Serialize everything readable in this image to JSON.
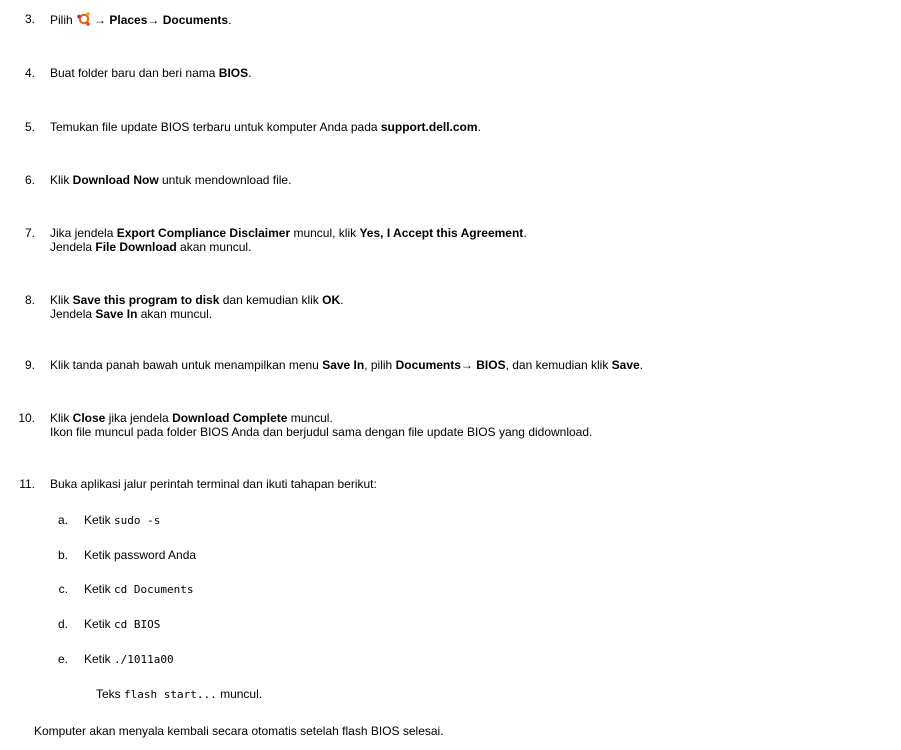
{
  "steps": [
    {
      "num": "3.",
      "t0": "Pilih ",
      "arrow": "→",
      "b1": " Places",
      "arrow2": "→",
      "b2": " Documents",
      "t_end": "."
    },
    {
      "num": "4.",
      "t0": "Buat folder baru dan beri nama ",
      "b1": "BIOS",
      "t_end": "."
    },
    {
      "num": "5.",
      "t0": "Temukan file update BIOS terbaru untuk komputer Anda pada ",
      "b1": "support.dell.com",
      "t_end": "."
    },
    {
      "num": "6.",
      "t0": "Klik ",
      "b1": "Download Now",
      "t1": " untuk mendownload file."
    },
    {
      "num": "7.",
      "t0": "Jika jendela ",
      "b1": "Export Compliance Disclaimer",
      "t1": " muncul, klik ",
      "b2": "Yes, I Accept this Agreement",
      "t_end": ".",
      "line2_t0": "Jendela ",
      "line2_b1": "File Download",
      "line2_t1": " akan muncul."
    },
    {
      "num": "8.",
      "t0": "Klik ",
      "b1": "Save this program to disk",
      "t1": " dan kemudian klik ",
      "b2": "OK",
      "t_end": ".",
      "line2_t0": "Jendela ",
      "line2_b1": "Save In",
      "line2_t1": " akan muncul."
    },
    {
      "num": "9.",
      "t0": "Klik tanda panah bawah untuk menampilkan menu ",
      "b1": "Save In",
      "t1": ", pilih ",
      "b2": "Documents",
      "arrow": "→",
      "b3": " BIOS",
      "t2": ", dan kemudian klik ",
      "b4": "Save",
      "t_end": "."
    },
    {
      "num": "10.",
      "t0": "Klik ",
      "b1": "Close",
      "t1": " jika jendela ",
      "b2": "Download Complete",
      "t2": " muncul.",
      "line2": "Ikon file muncul pada folder BIOS Anda dan berjudul sama dengan file update BIOS yang didownload."
    },
    {
      "num": "11.",
      "t0": "Buka aplikasi jalur perintah terminal dan ikuti tahapan berikut:"
    }
  ],
  "substeps": [
    {
      "letter": "a.",
      "text": "Ketik ",
      "code": "sudo -s"
    },
    {
      "letter": "b.",
      "text": "Ketik password Anda",
      "code": ""
    },
    {
      "letter": "c.",
      "text": "Ketik ",
      "code": "cd Documents"
    },
    {
      "letter": "d.",
      "text": "Ketik ",
      "code": "cd BIOS"
    },
    {
      "letter": "e.",
      "text": "Ketik ",
      "code": "./1011a00"
    }
  ],
  "note": {
    "t0": "Teks ",
    "code": "flash start...",
    "t1": " muncul."
  },
  "final": "Komputer akan menyala kembali secara otomatis setelah flash BIOS selesai.",
  "icon_name": "ubuntu-logo-icon"
}
